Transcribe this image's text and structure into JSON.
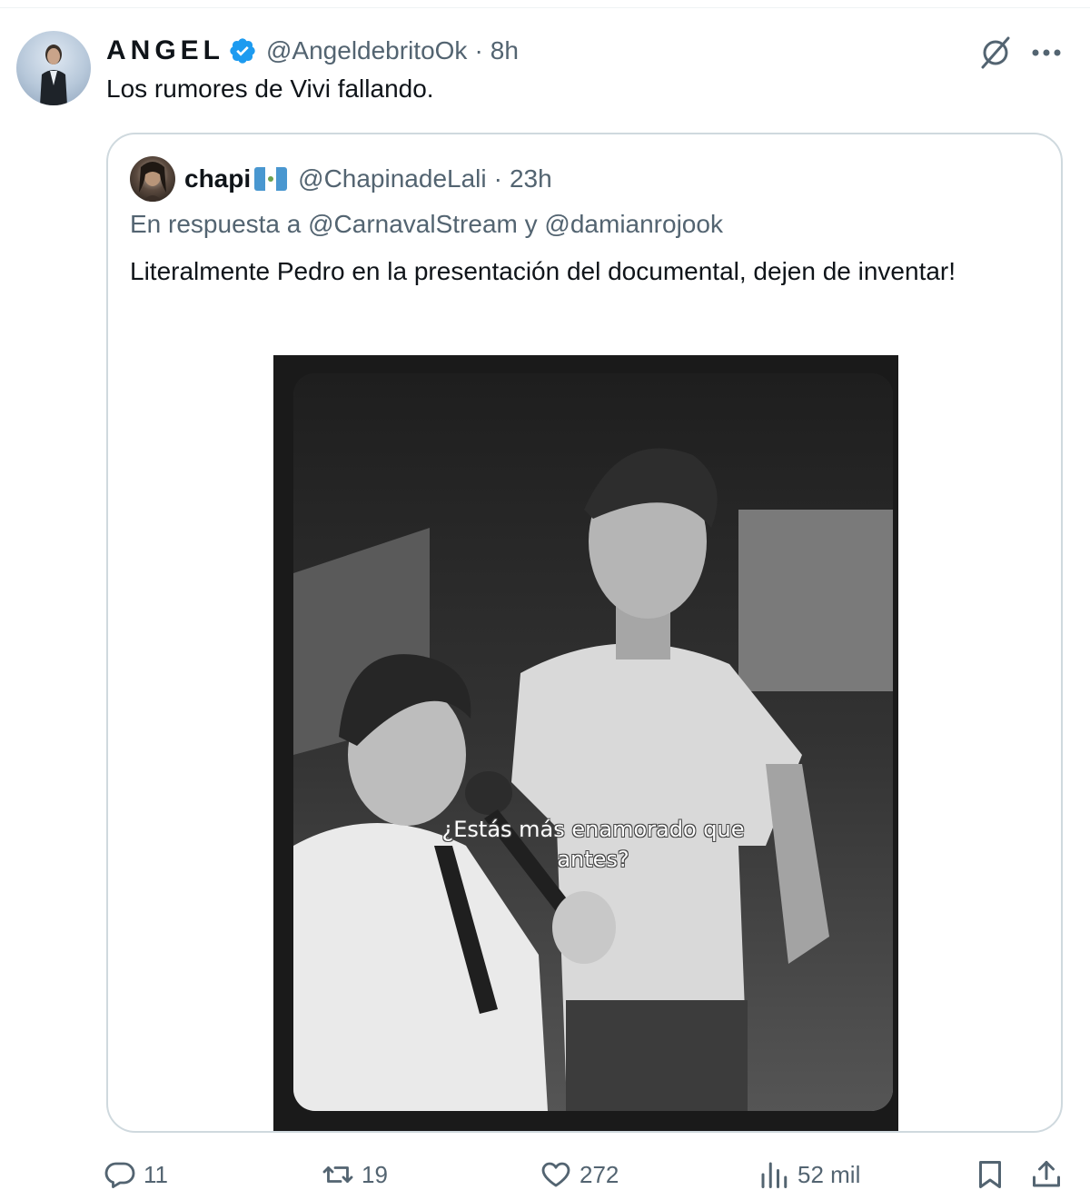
{
  "tweet": {
    "author": {
      "display_name": "ANGEL",
      "handle": "@AngeldebritoOk",
      "verified": true
    },
    "time": "8h",
    "separator": "·",
    "text": "Los rumores de Vivi fallando.",
    "icons": [
      "grok-icon",
      "more-icon"
    ]
  },
  "quoted": {
    "author": {
      "display_name": "chapi",
      "flag": "guatemala-flag",
      "handle": "@ChapinadeLali"
    },
    "time": "23h",
    "separator": "·",
    "reply_prefix": "En respuesta a",
    "reply_mention_1": "@CarnavalStream",
    "reply_conjunction": "y",
    "reply_mention_2": "@damianrojook",
    "text": "Literalmente Pedro en la presentación del documental, dejen de inventar!",
    "media_caption_line1": "¿Estás más enamorado que",
    "media_caption_line2": "antes?"
  },
  "actions": {
    "replies": "11",
    "reposts": "19",
    "likes": "272",
    "views": "52 mil"
  },
  "colors": {
    "verified_blue": "#1d9bf0",
    "text_primary": "#0f1419",
    "text_secondary": "#536471",
    "border": "#cfd9de"
  }
}
